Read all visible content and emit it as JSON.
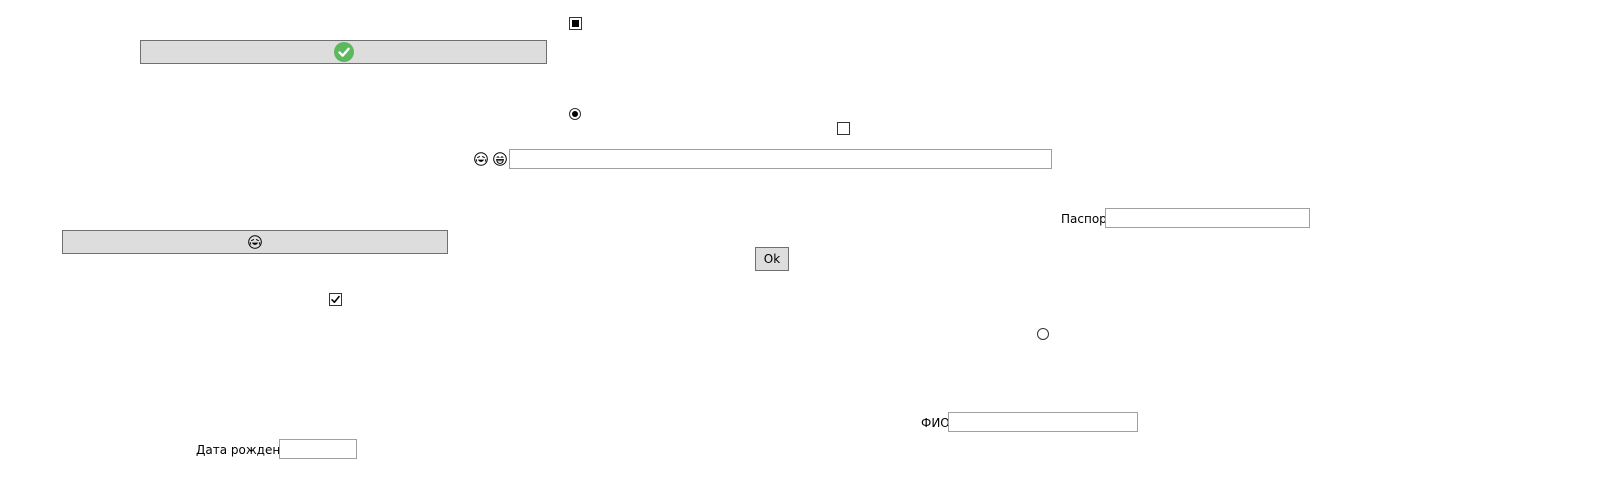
{
  "ok_button": {
    "label": "Ok"
  },
  "passport": {
    "label": "Паспорт",
    "value": ""
  },
  "fio": {
    "label": "ФИО",
    "value": ""
  },
  "birth_date": {
    "label": "Дата рождения",
    "value": ""
  },
  "emoji_text_field": {
    "value": ""
  },
  "colors": {
    "success_green": "#5cb85c",
    "button_gray": "#dddddd",
    "border": "#707070"
  },
  "icons": {
    "confirm_button_icon": "green-check-icon",
    "emoji_button_icon": "laughing-face-icon",
    "field_icon_1": "laughing-face-icon",
    "field_icon_2": "grinning-face-icon"
  },
  "toggles": {
    "checkbox_top": "indeterminate",
    "checkbox_middle": "unchecked",
    "checkbox_left": "checked",
    "radio_top": "selected",
    "radio_right": "unselected"
  }
}
